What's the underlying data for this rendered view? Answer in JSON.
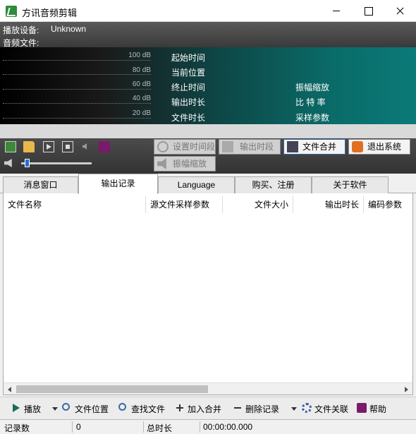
{
  "window": {
    "title": "方讯音频剪辑"
  },
  "info": {
    "device_label": "播放设备:",
    "device_value": "Unknown",
    "file_label": "音频文件:"
  },
  "meter": {
    "db_labels": [
      "100 dB",
      "80 dB",
      "60 dB",
      "40 dB",
      "20 dB"
    ],
    "col1": [
      "起始时间",
      "当前位置",
      "终止时间",
      "输出时长",
      "文件时长"
    ],
    "col2": [
      "振幅缩放",
      "比 特 率",
      "采样参数"
    ]
  },
  "toolbar": {
    "set_segment": "设置时间段",
    "output_segment": "输出时段",
    "file_merge": "文件合并",
    "exit_system": "退出系统",
    "amplitude_scale": "振幅缩放",
    "volume_level": 0.05
  },
  "tabs": [
    "消息窗口",
    "输出记录",
    "Language",
    "购买、注册",
    "关于软件"
  ],
  "selected_tab": "输出记录",
  "table": {
    "columns": [
      "文件名称",
      "源文件采样参数",
      "文件大小",
      "输出时长",
      "编码参数"
    ],
    "rows": []
  },
  "bottom_toolbar": {
    "play": "播放",
    "file_location": "文件位置",
    "find_file": "查找文件",
    "add_merge": "加入合并",
    "delete_record": "删除记录",
    "file_assoc": "文件关联",
    "help": "帮助"
  },
  "status": {
    "records_label": "记录数",
    "records_value": "0",
    "total_label": "总时长",
    "total_value": "00:00:00.000"
  }
}
